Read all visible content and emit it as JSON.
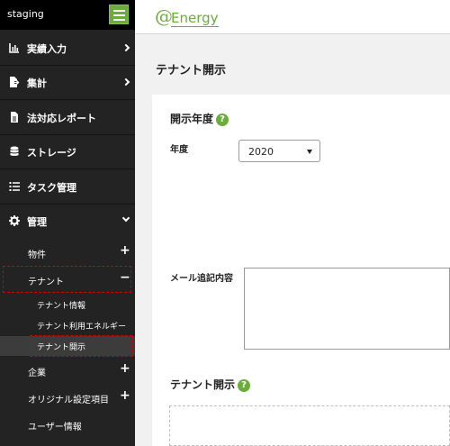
{
  "sidebar": {
    "env_label": "staging",
    "menu_icon": "hamburger-menu-icon",
    "nav": [
      {
        "label": "実績入力",
        "icon": "bar-chart-icon"
      },
      {
        "label": "集計",
        "icon": "file-export-icon"
      },
      {
        "label": "法対応レポート",
        "icon": "document-icon"
      },
      {
        "label": "ストレージ",
        "icon": "database-icon"
      },
      {
        "label": "タスク管理",
        "icon": "task-list-icon"
      },
      {
        "label": "管理",
        "icon": "gear-icon"
      }
    ],
    "sub": [
      {
        "label": "物件",
        "toggle": "+"
      },
      {
        "label": "テナント",
        "toggle": "−"
      },
      {
        "label": "企業",
        "toggle": "+"
      },
      {
        "label": "オリジナル設定項目",
        "toggle": "+"
      },
      {
        "label": "ユーザー情報",
        "toggle": ""
      }
    ],
    "tenant_children": [
      "テナント情報",
      "テナント利用エネルギー",
      "テナント開示"
    ]
  },
  "header": {
    "logo_at": "@",
    "logo_text": "Energy"
  },
  "main": {
    "page_title": "テナント開示",
    "disclosure_year": {
      "title": "開示年度",
      "help": "?",
      "field_label": "年度",
      "selected": "2020"
    },
    "mail_label": "メール追記内容",
    "disclosure": {
      "title": "テナント開示",
      "help": "?"
    }
  },
  "colors": {
    "accent": "#6aad3a",
    "sidebar": "#232323",
    "highlight_border": "#d40000"
  }
}
